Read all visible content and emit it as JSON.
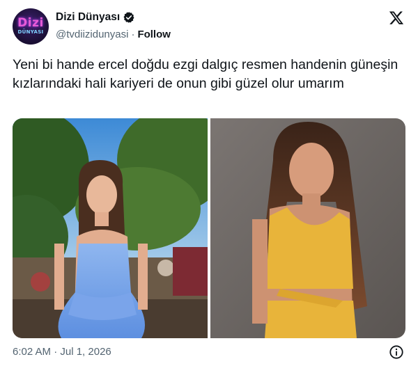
{
  "account": {
    "display_name": "Dizi Dünyası",
    "handle": "@tvdiizidunyasi",
    "separator": "·",
    "follow_label": "Follow",
    "avatar_logo_top": "Dizi",
    "avatar_logo_bottom": "DÜNYASI"
  },
  "tweet": {
    "text": "Yeni bi hande ercel doğdu ezgi dalgıç resmen handenin güneşin kızlarındaki hali kariyeri de onun gibi güzel olur umarım",
    "timestamp": "6:02 AM · Jul 1, 2026"
  },
  "icons": {
    "verified": "verified-badge-icon",
    "brand": "x-logo-icon",
    "info": "info-icon"
  },
  "colors": {
    "text_primary": "#0f1419",
    "text_secondary": "#536471",
    "verified_badge": "#0f1419"
  }
}
